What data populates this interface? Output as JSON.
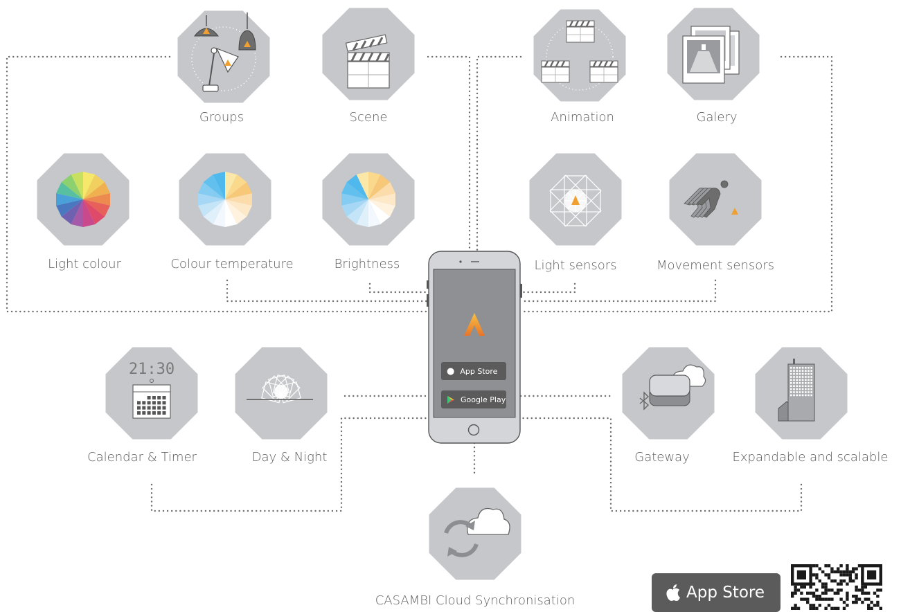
{
  "features": {
    "groups": "Groups",
    "scene": "Scene",
    "animation": "Animation",
    "galery": "Galery",
    "light_colour": "Light colour",
    "colour_temperature": "Colour temperature",
    "brightness": "Brightness",
    "light_sensors": "Light sensors",
    "movement_sensors": "Movement sensors",
    "calendar_timer": "Calendar & Timer",
    "day_night": "Day & Night",
    "gateway": "Gateway",
    "expandable": "Expandable and scalable",
    "cloud_sync": "CASAMBI Cloud Synchronisation"
  },
  "calendar_clock": "21:30",
  "phone": {
    "app_store_badge": "App Store",
    "google_play_badge": "Google Play"
  },
  "footer": {
    "app_store_badge": "App Store"
  },
  "colors": {
    "tile": "#c6c7cb",
    "dots": "#6d6d6d",
    "label": "#5d5d5d",
    "accent": "#f0a030"
  }
}
